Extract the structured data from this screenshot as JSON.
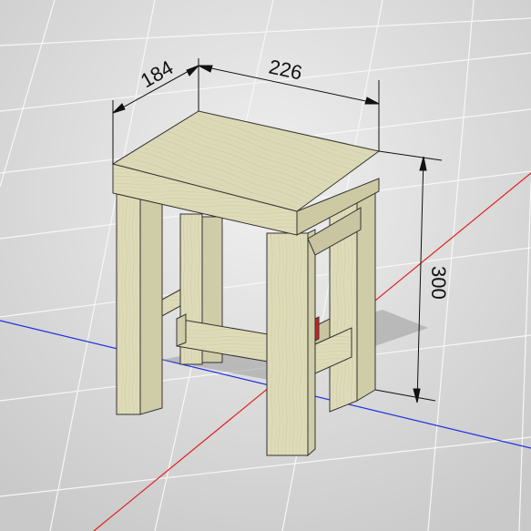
{
  "model": {
    "name": "stool",
    "dimensions": {
      "width": "226",
      "depth": "184",
      "height": "300"
    }
  },
  "scene": {
    "axis_colors": {
      "x_axis": "#e02020",
      "y_axis": "#2030e0"
    },
    "wood_color": "#dedbb8",
    "background": "#e4e4e4",
    "grid_color": "#f4f4f4"
  }
}
